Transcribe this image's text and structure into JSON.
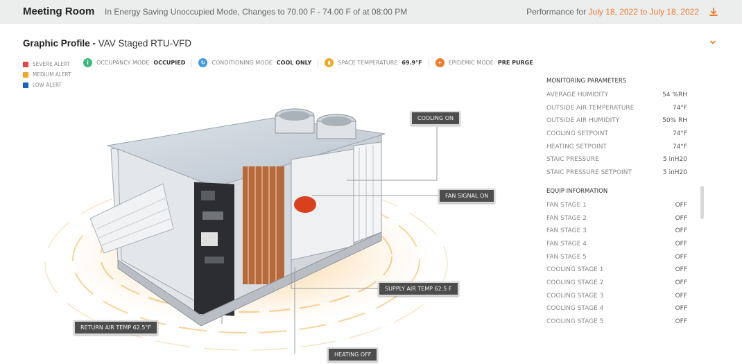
{
  "header": {
    "room_title": "Meeting Room",
    "mode_text": "In Energy Saving Unoccupied Mode, Changes  to 70.00 F - 74.00 F of at 08:00 PM",
    "performance_label": "Performance for",
    "date_from": "July 18, 2022",
    "date_to_word": "to",
    "date_to": "July 18, 2022",
    "download_icon": "download-icon"
  },
  "profile": {
    "title": "Graphic Profile -",
    "subtitle": "VAV Staged RTU-VFD",
    "collapse_icon": "chevron-down-icon"
  },
  "legend": [
    {
      "label": "SEVERE ALERT",
      "color": "#e84545"
    },
    {
      "label": "MEDIUM ALERT",
      "color": "#f5a623"
    },
    {
      "label": "LOW ALERT",
      "color": "#1565c0"
    }
  ],
  "status": {
    "occupancy": {
      "label": "OCCUPANCY MODE",
      "value": "OCCUPIED",
      "color": "#3cb878"
    },
    "conditioning": {
      "label": "CONDITIONING MODE",
      "value": "COOL ONLY",
      "color": "#3a9be0"
    },
    "space_temp": {
      "label": "SPACE TEMPERATURE",
      "value": "69.9°F",
      "color": "#f5a623"
    },
    "epidemic": {
      "label": "EPIDEMIC MODE",
      "value": "PRE PURGE",
      "color": "#f07a2a"
    }
  },
  "callouts": {
    "cooling": "COOLING  ON",
    "fan_signal": "FAN SIGNAL  ON",
    "supply_air": "SUPPLY AIR TEMP   62.5 F",
    "return_air": "RETURN AIR TEMP   62.5°F",
    "heating": "HEATING  OFF"
  },
  "monitoring": {
    "title": "MONITORING PARAMETERS",
    "rows": [
      {
        "label": "AVERAGE HUMIDITY",
        "value": "54 %RH"
      },
      {
        "label": "OUTSIDE AIR TEMPERATURE",
        "value": "74°F"
      },
      {
        "label": "OUTSIDE AIR HUMIDITY",
        "value": "50% RH"
      },
      {
        "label": "COOLING SETPOINT",
        "value": "74°F"
      },
      {
        "label": "HEATING SETPOINT",
        "value": "74°F"
      },
      {
        "label": "STAIC PRESSURE",
        "value": "5 inH20"
      },
      {
        "label": "STAIC PRESSURE SETPOINT",
        "value": "5 inH20"
      }
    ]
  },
  "equip": {
    "title": "EQUIP INFORMATION",
    "rows": [
      {
        "label": "FAN STAGE 1",
        "value": "OFF"
      },
      {
        "label": "FAN STAGE 2",
        "value": "OFF"
      },
      {
        "label": "FAN STAGE 3",
        "value": "OFF"
      },
      {
        "label": "FAN STAGE 4",
        "value": "OFF"
      },
      {
        "label": "FAN STAGE 5",
        "value": "OFF"
      },
      {
        "label": "COOLING STAGE 1",
        "value": "OFF"
      },
      {
        "label": "COOLING STAGE 2",
        "value": "OFF"
      },
      {
        "label": "COOLING STAGE 3",
        "value": "OFF"
      },
      {
        "label": "COOLING STAGE 4",
        "value": "OFF"
      },
      {
        "label": "COOLING STAGE 5",
        "value": "OFF"
      }
    ]
  }
}
